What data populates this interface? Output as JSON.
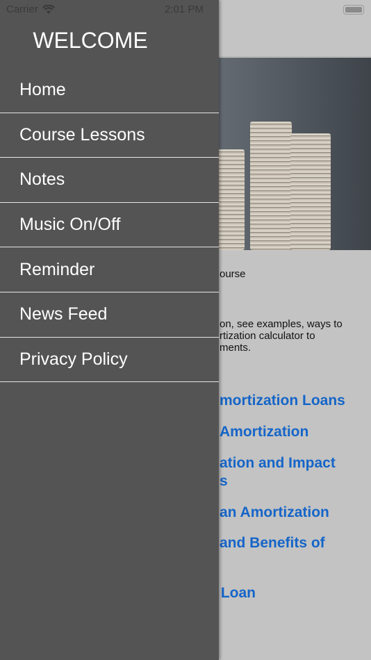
{
  "status_bar": {
    "carrier": "Carrier",
    "time": "2:01 PM",
    "wifi_icon": "wifi-icon",
    "battery_icon": "battery-icon"
  },
  "drawer": {
    "title": "WELCOME",
    "items": [
      {
        "label": "Home"
      },
      {
        "label": "Course Lessons"
      },
      {
        "label": "Notes"
      },
      {
        "label": "Music On/Off"
      },
      {
        "label": "Reminder"
      },
      {
        "label": "News Feed"
      },
      {
        "label": "Privacy Policy"
      }
    ]
  },
  "main": {
    "intro_fragment": "ourse",
    "description_lines": [
      "on, see examples, ways to",
      "rtization calculator to",
      "ments."
    ],
    "lesson_links": [
      {
        "lines": [
          "mortization Loans"
        ]
      },
      {
        "lines": [
          "Amortization"
        ]
      },
      {
        "lines": [
          "ation and Impact",
          "s"
        ]
      },
      {
        "lines": [
          "an Amortization"
        ]
      },
      {
        "lines": [
          "and Benefits of",
          ""
        ]
      },
      {
        "lines": [
          " Loan"
        ]
      }
    ]
  },
  "colors": {
    "drawer": "#545454",
    "link": "#1565c8",
    "dim_background": "#c3c3c3"
  }
}
